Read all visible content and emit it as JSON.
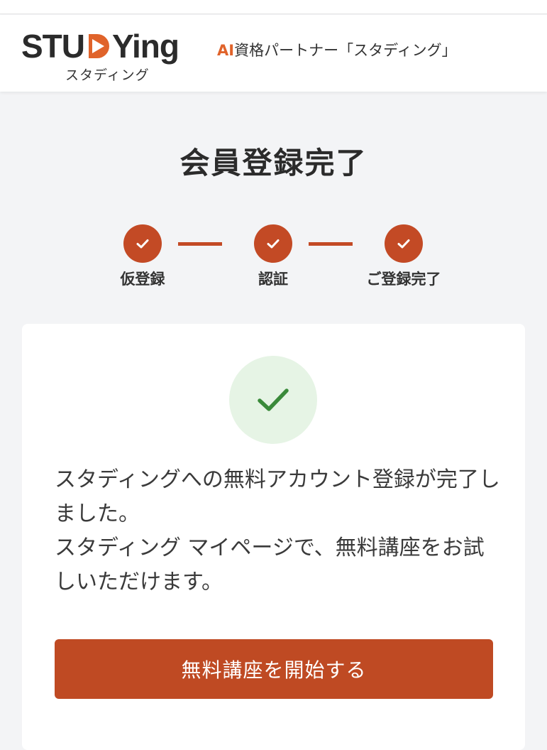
{
  "header": {
    "logo_text_before": "STU",
    "logo_text_after": "Ying",
    "logo_subtitle": "スタディング",
    "tagline_ai": "AI",
    "tagline_rest": "資格パートナー「スタディング」"
  },
  "main": {
    "title": "会員登録完了"
  },
  "steps": [
    {
      "label": "仮登録"
    },
    {
      "label": "認証"
    },
    {
      "label": "ご登録完了"
    }
  ],
  "card": {
    "message_line1": "スタディングへの無料アカウント登録が完了しました。",
    "message_line2": "スタディング マイページで、無料講座をお試しいただけます。",
    "button_label": "無料講座を開始する"
  },
  "colors": {
    "accent": "#c34a25",
    "button": "#bf4a23",
    "success_bg": "#e6f4e5",
    "success_check": "#3a8a3a",
    "ai_orange": "#e0632a"
  }
}
